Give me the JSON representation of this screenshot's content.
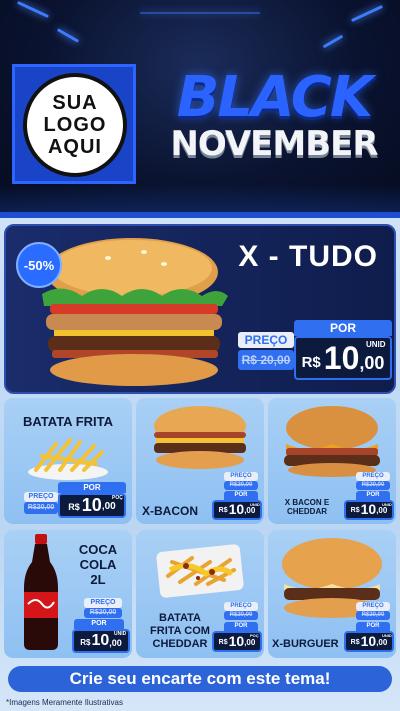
{
  "header": {
    "logo_lines": [
      "SUA",
      "LOGO",
      "AQUI"
    ],
    "title_top": "BLACK",
    "title_bottom": "NOVEMBER"
  },
  "hero": {
    "badge": "-50%",
    "name": "X - TUDO",
    "por_label": "POR",
    "preco_label": "PREÇO",
    "old_price": "R$ 20,00",
    "currency": "R$",
    "price_int": "10",
    "price_dec": ",00",
    "unit": "UNID"
  },
  "products": [
    {
      "name": "BATATA FRITA",
      "por_label": "POR",
      "preco_label": "PREÇO",
      "old_price": "R$20,00",
      "currency": "R$",
      "price_int": "10",
      "price_dec": ",00",
      "unit": "POÇ"
    },
    {
      "name": "X-BACON",
      "por_label": "POR",
      "preco_label": "PREÇO",
      "old_price": "R$20,00",
      "currency": "R$",
      "price_int": "10",
      "price_dec": ",00",
      "unit": "UNID"
    },
    {
      "name_line1": "X BACON E",
      "name_line2": "CHEDDAR",
      "por_label": "POR",
      "preco_label": "PREÇO",
      "old_price": "R$20,00",
      "currency": "R$",
      "price_int": "10",
      "price_dec": ",00",
      "unit": "UNID"
    },
    {
      "name_line1": "COCA",
      "name_line2": "COLA",
      "name_line3": "2L",
      "por_label": "POR",
      "preco_label": "PREÇO",
      "old_price": "R$20,00",
      "currency": "R$",
      "price_int": "10",
      "price_dec": ",00",
      "unit": "UNID"
    },
    {
      "name_line1": "BATATA",
      "name_line2": "FRITA COM",
      "name_line3": "CHEDDAR",
      "por_label": "POR",
      "preco_label": "PREÇO",
      "old_price": "R$20,00",
      "currency": "R$",
      "price_int": "10",
      "price_dec": ",00",
      "unit": "POÇ"
    },
    {
      "name": "X-BURGUER",
      "por_label": "POR",
      "preco_label": "PREÇO",
      "old_price": "R$20,00",
      "currency": "R$",
      "price_int": "10",
      "price_dec": ",00",
      "unit": "UNID"
    }
  ],
  "footer": {
    "cta": "Crie seu encarte com este tema!",
    "disclaimer": "*Imagens Meramente Ilustrativas"
  },
  "icons": [
    "burger-image",
    "fries-image",
    "soda-bottle-image",
    "cheddar-fries-image"
  ],
  "colors": {
    "accent": "#2f6ff0",
    "dark": "#0b1a3d",
    "card": "#a9d0f5"
  }
}
